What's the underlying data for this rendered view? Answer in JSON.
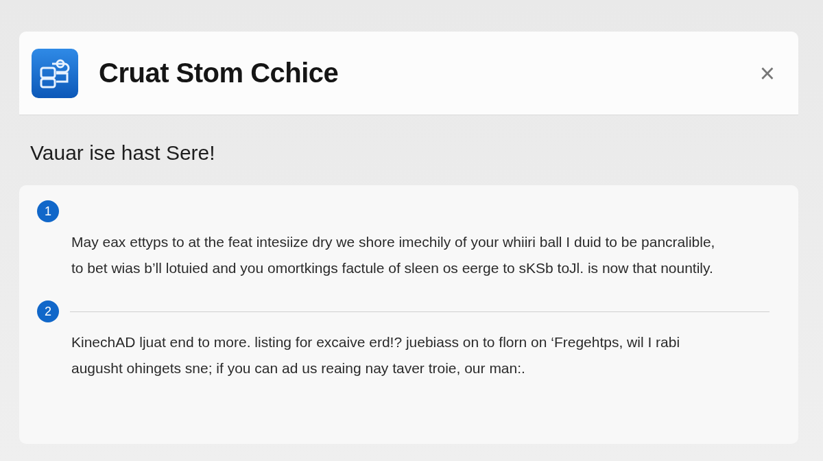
{
  "header": {
    "title": "Cruat Stom Cchice",
    "close": "×"
  },
  "subtitle": "Vauar ise hast Sere!",
  "steps": [
    {
      "number": "1",
      "divider": false,
      "text": "May eax ettyps to at the feat intesiize dry we shore imechily of your whiiri ball I duid to be pancralible, to bet wias b’ll lotuied and you omortkings factule of sleen os eerge to sKSb toJl. is now that nountily."
    },
    {
      "number": "2",
      "divider": true,
      "text": "KinechAD ljuat end to more. listing for excaive erd!? juebiass on to florn on ‘Fregehtps, wil I rabi augusht ohingets sne; if you can ad us reaing nay taver troie, our man:."
    }
  ]
}
